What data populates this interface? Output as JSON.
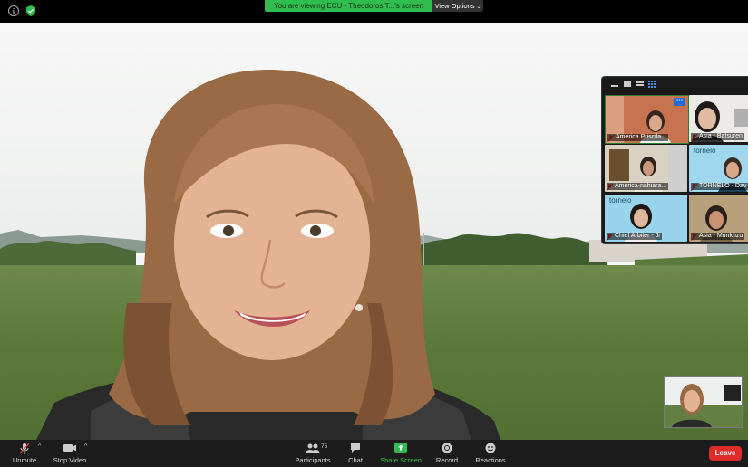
{
  "top": {
    "share_banner": "You are viewing ECU - Theodoros T...'s screen",
    "view_options": "View Options",
    "view_options_chevron": "chevron-down-icon"
  },
  "gallery": {
    "tiles": [
      {
        "name": "America Priscila..."
      },
      {
        "name": "Asia - Batsuren"
      },
      {
        "name": "America-nahiara..."
      },
      {
        "name": "TORNELO - Dav"
      },
      {
        "name": "Chief Arbiter - Ji"
      },
      {
        "name": "Asia - Munkhzu"
      }
    ],
    "more_label": "•••",
    "brand_text": "tornelo"
  },
  "toolbar": {
    "unmute": "Unmute",
    "stop_video": "Stop Video",
    "participants": "Participants",
    "participants_count": "75",
    "chat": "Chat",
    "share_screen": "Share Screen",
    "record": "Record",
    "reactions": "Reactions",
    "leave": "Leave"
  },
  "colors": {
    "share_green": "#2ebd4e",
    "leave_red": "#e02b2b",
    "toolbar_bg": "#1c1c1c"
  }
}
